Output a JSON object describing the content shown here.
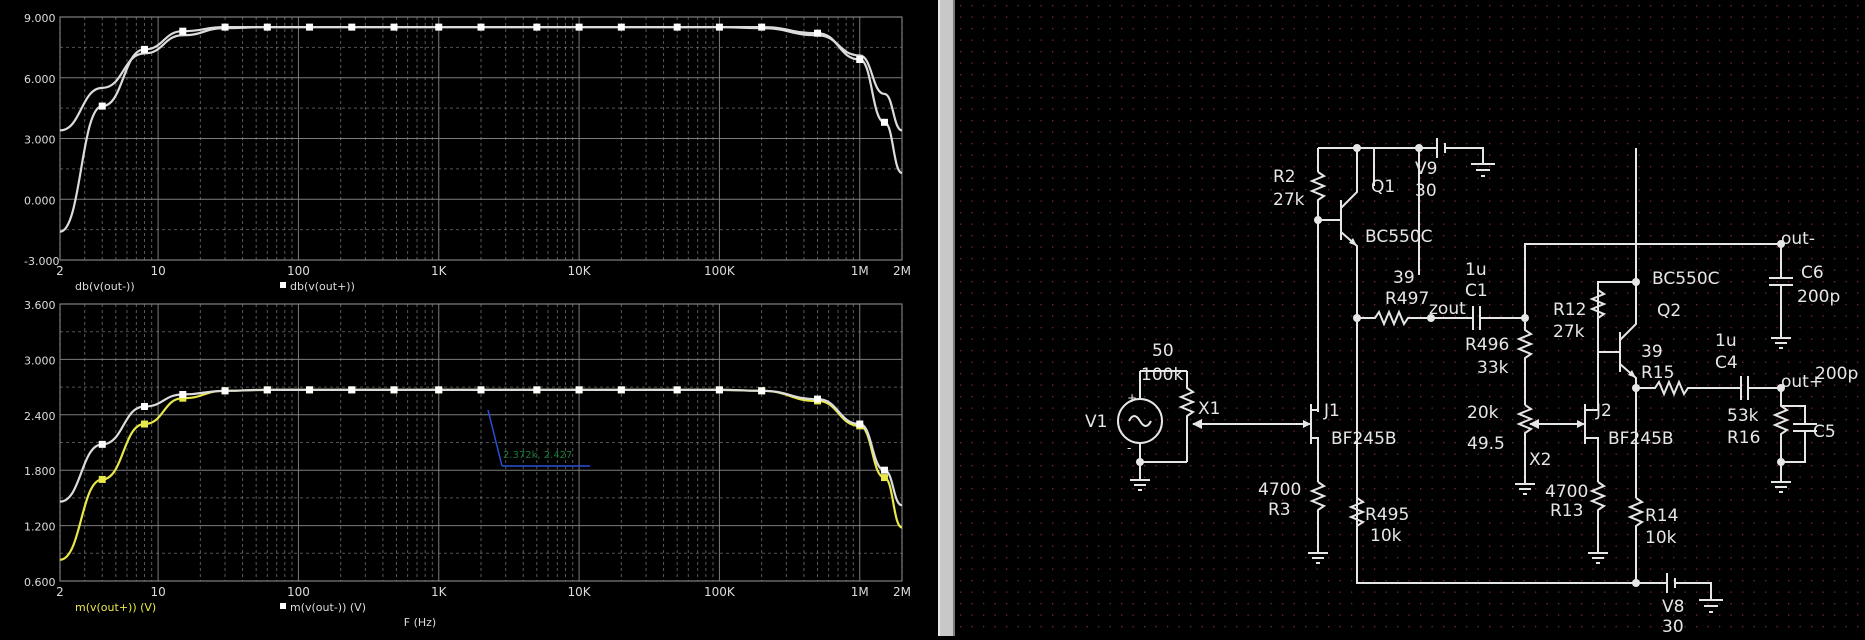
{
  "plots": [
    {
      "ylim": [
        -3,
        9
      ],
      "yticks": [
        "9.000",
        "6.000",
        "3.000",
        "0.000",
        "-3.000"
      ],
      "legend": [
        {
          "label": "db(v(out-))",
          "color": "#dcdcdc",
          "marker": false
        },
        {
          "label": "db(v(out+))",
          "color": "#dcdcdc",
          "marker": true
        }
      ]
    },
    {
      "ylim": [
        0.6,
        3.6
      ],
      "yticks": [
        "3.600",
        "3.000",
        "2.400",
        "1.800",
        "1.200",
        "0.600"
      ],
      "legend": [
        {
          "label": "m(v(out+)) (V)",
          "color": "#e8e84a",
          "marker": false
        },
        {
          "label": "m(v(out-)) (V)",
          "color": "#dcdcdc",
          "marker": true
        }
      ],
      "xlabel": "F (Hz)",
      "cursor_label": "2.372k, 2.427"
    }
  ],
  "xticks": [
    "2",
    "10",
    "100",
    "1K",
    "10K",
    "100K",
    "1M",
    "2M"
  ],
  "chart_data": [
    {
      "type": "line",
      "xscale": "log",
      "xlim": [
        2,
        2000000
      ],
      "ylim": [
        -3,
        9
      ],
      "grid": true,
      "x": [
        2,
        4,
        8,
        15,
        30,
        60,
        120,
        240,
        480,
        1000,
        2000,
        5000,
        10000,
        20000,
        50000,
        100000,
        200000,
        500000,
        1000000,
        1500000,
        2000000
      ],
      "series": [
        {
          "name": "db(v(out-))",
          "values": [
            3.4,
            5.5,
            7.2,
            8.1,
            8.45,
            8.5,
            8.5,
            8.5,
            8.5,
            8.5,
            8.5,
            8.5,
            8.5,
            8.5,
            8.5,
            8.5,
            8.45,
            8.1,
            7.1,
            5.2,
            3.4
          ]
        },
        {
          "name": "db(v(out+))",
          "values": [
            -1.6,
            4.6,
            7.4,
            8.3,
            8.5,
            8.5,
            8.5,
            8.5,
            8.5,
            8.5,
            8.5,
            8.5,
            8.5,
            8.5,
            8.5,
            8.5,
            8.5,
            8.2,
            6.9,
            3.8,
            1.3
          ]
        }
      ]
    },
    {
      "type": "line",
      "xscale": "log",
      "xlim": [
        2,
        2000000
      ],
      "ylim": [
        0.6,
        3.6
      ],
      "grid": true,
      "xlabel": "F (Hz)",
      "x": [
        2,
        4,
        8,
        15,
        30,
        60,
        120,
        240,
        480,
        1000,
        2000,
        5000,
        10000,
        20000,
        50000,
        100000,
        200000,
        500000,
        1000000,
        1500000,
        2000000
      ],
      "series": [
        {
          "name": "m(v(out+)) (V)",
          "values": [
            0.83,
            1.7,
            2.3,
            2.58,
            2.66,
            2.67,
            2.67,
            2.67,
            2.67,
            2.67,
            2.67,
            2.67,
            2.67,
            2.67,
            2.67,
            2.67,
            2.66,
            2.55,
            2.28,
            1.72,
            1.18
          ]
        },
        {
          "name": "m(v(out-)) (V)",
          "values": [
            1.46,
            2.08,
            2.49,
            2.62,
            2.66,
            2.67,
            2.67,
            2.67,
            2.67,
            2.67,
            2.67,
            2.67,
            2.67,
            2.67,
            2.67,
            2.67,
            2.66,
            2.57,
            2.3,
            1.8,
            1.42
          ]
        }
      ]
    }
  ],
  "colors": {
    "trace_white": "#dcdcdc",
    "trace_yellow": "#e8e84a",
    "grid": "#8a8a8a",
    "cursor": "#2a4fd8",
    "cursor_text": "#1a7a3a"
  },
  "schematic": {
    "R2": "R2",
    "R2_val": "27k",
    "Q1": "Q1",
    "Q1_model": "BC550C",
    "V9": "V9",
    "V9_val": "30",
    "V8": "V8",
    "V8_val": "30",
    "R497": "R497",
    "R497_val": "39",
    "C1": "C1",
    "C1_val": "1u",
    "zout": "zout",
    "out_minus": "out-",
    "C6": "C6",
    "C6_val": "200p",
    "Q2_model": "BC550C",
    "Q2": "Q2",
    "R12": "R12",
    "R12_val": "27k",
    "R496": "R496",
    "R496_val": "33k",
    "R15_val": "39",
    "R15": "R15",
    "C4_val": "1u",
    "C4": "C4",
    "out_plus": "out+",
    "C5": "C5",
    "C5_val": "200p",
    "R16_val": "53k",
    "R16": "R16",
    "pot1_a": "50",
    "pot1_b": "100k",
    "X1": "X1",
    "V1": "V1",
    "J1": "J1",
    "J1_model": "BF245B",
    "pot2_a": "20k",
    "pot2_b": "49.5",
    "X2": "X2",
    "J2": "J2",
    "J2_model": "BF245B",
    "R3_val": "4700",
    "R3": "R3",
    "R495": "R495",
    "R495_val": "10k",
    "R13_val": "4700",
    "R13": "R13",
    "R14": "R14",
    "R14_val": "10k"
  }
}
